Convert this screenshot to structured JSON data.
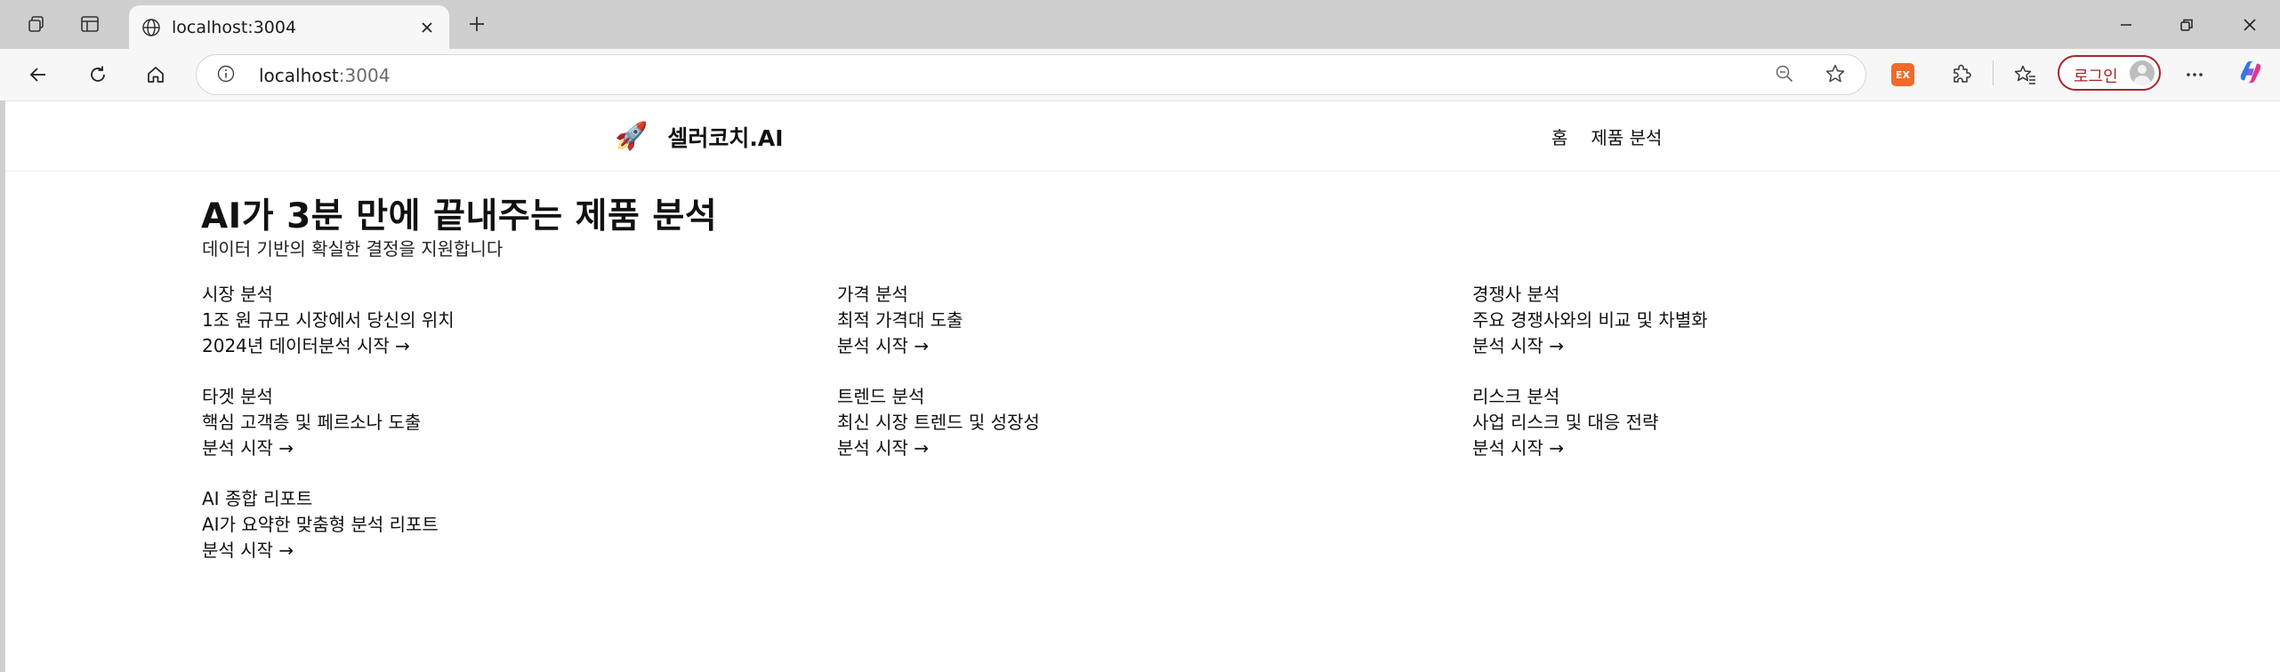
{
  "browser": {
    "tab_title": "localhost:3004",
    "url_host": "localhost",
    "url_port": ":3004",
    "login_label": "로그인",
    "extension_badge": "EX",
    "accent_color": "#a4262c"
  },
  "site": {
    "logo_emoji": "🚀",
    "brand": "셀러코치.AI",
    "nav": [
      {
        "label": "홈"
      },
      {
        "label": "제품 분석"
      }
    ]
  },
  "hero": {
    "title": "AI가 3분 만에 끝내주는 제품 분석",
    "subtitle": "데이터 기반의 확실한 결정을 지원합니다"
  },
  "cards": [
    {
      "title": "시장 분석",
      "desc": "1조 원 규모 시장에서 당신의 위치",
      "link": "2024년 데이터분석 시작 →"
    },
    {
      "title": "가격 분석",
      "desc": "최적 가격대 도출",
      "link": "분석 시작 →"
    },
    {
      "title": "경쟁사 분석",
      "desc": "주요 경쟁사와의 비교 및 차별화",
      "link": "분석 시작 →"
    },
    {
      "title": "타겟 분석",
      "desc": "핵심 고객층 및 페르소나 도출",
      "link": "분석 시작 →"
    },
    {
      "title": "트렌드 분석",
      "desc": "최신 시장 트렌드 및 성장성",
      "link": "분석 시작 →"
    },
    {
      "title": "리스크 분석",
      "desc": "사업 리스크 및 대응 전략",
      "link": "분석 시작 →"
    },
    {
      "title": "AI 종합 리포트",
      "desc": "AI가 요약한 맞춤형 분석 리포트",
      "link": "분석 시작 →"
    }
  ]
}
